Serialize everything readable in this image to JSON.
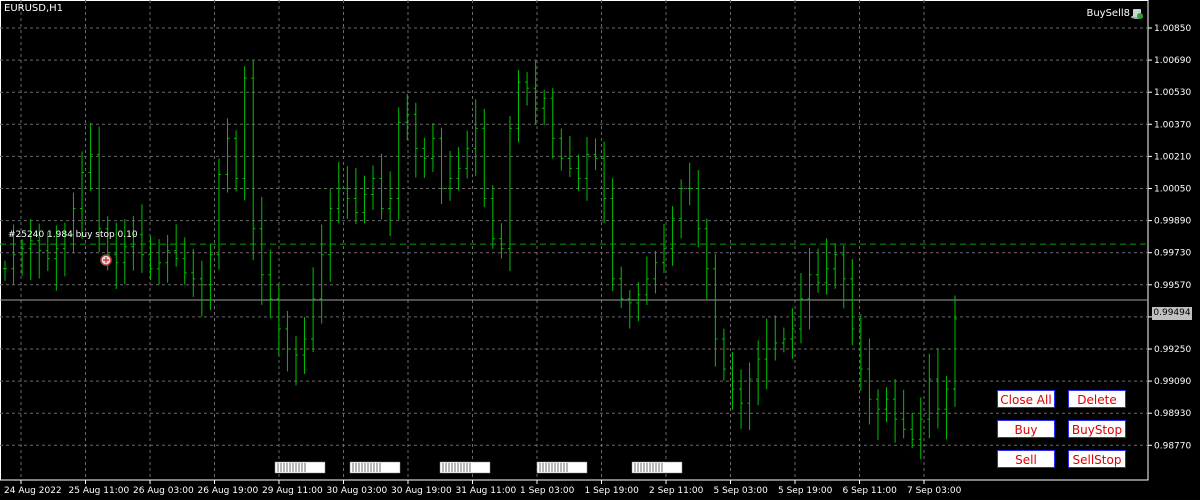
{
  "symbol_title": "EURUSD,H1",
  "ea_name": "BuySell8",
  "ea_icon": "expert-advisor-hat-icon",
  "pending_order_label": "#25240 1.984 buy stop 0.10",
  "current_price": "0.99494",
  "buttons": {
    "close_all": "Close All",
    "delete": "Delete",
    "buy": "Buy",
    "buy_stop": "BuyStop",
    "sell": "Sell",
    "sell_stop": "SellStop"
  },
  "colors": {
    "background": "#000000",
    "candles": "#00c000",
    "grid": "#6a6a6a",
    "order_line": "#00a000",
    "price_line": "#a0a0a0",
    "button_text": "#e00000",
    "button_border": "#2a2aff"
  },
  "chart_data": {
    "type": "line",
    "ylim": [
      0.9862,
      1.0095
    ],
    "y_ticks": [
      "1.00850",
      "1.00690",
      "1.00530",
      "1.00370",
      "1.00210",
      "1.00050",
      "0.99890",
      "0.99730",
      "0.99570",
      "0.99410",
      "0.99250",
      "0.99090",
      "0.98930",
      "0.98770"
    ],
    "x_ticks": [
      "24 Aug 2022",
      "25 Aug 11:00",
      "26 Aug 03:00",
      "26 Aug 19:00",
      "29 Aug 11:00",
      "30 Aug 03:00",
      "30 Aug 19:00",
      "31 Aug 11:00",
      "1 Sep 03:00",
      "1 Sep 19:00",
      "2 Sep 11:00",
      "5 Sep 03:00",
      "5 Sep 19:00",
      "6 Sep 11:00",
      "7 Sep 03:00"
    ],
    "order_level": 0.99773,
    "price_level": 0.99494,
    "closes": [
      0.9965,
      0.9972,
      0.9975,
      0.9979,
      0.9974,
      0.997,
      0.9975,
      0.9982,
      0.9995,
      1.0013,
      1.0022,
      0.9985,
      0.9972,
      0.9968,
      0.9976,
      0.9982,
      0.9972,
      0.9965,
      0.9968,
      0.9974,
      0.997,
      0.9963,
      0.996,
      0.9957,
      0.9972,
      1.0012,
      1.003,
      1.001,
      1.006,
      0.9985,
      0.9962,
      0.995,
      0.9935,
      0.9925,
      0.9922,
      0.993,
      0.995,
      0.9972,
      0.9995,
      1.0005,
      1.0,
      0.9993,
      1.0002,
      1.001,
      0.9995,
      1.0,
      1.0038,
      1.0042,
      1.0025,
      1.002,
      1.003,
      1.0005,
      1.001,
      1.0015,
      1.0025,
      1.0035,
      1.0,
      0.998,
      0.9975,
      1.0035,
      1.0058,
      1.0055,
      1.0045,
      1.005,
      1.003,
      1.002,
      1.0015,
      1.001,
      1.0022,
      1.002,
      1.0,
      0.996,
      0.995,
      0.9948,
      0.9952,
      0.996,
      0.9968,
      0.9975,
      0.999,
      1.0005,
      1.0005,
      0.9985,
      0.9965,
      0.993,
      0.9915,
      0.9905,
      0.9898,
      0.991,
      0.992,
      0.9925,
      0.9928,
      0.993,
      0.9935,
      0.995,
      0.9962,
      0.9958,
      0.9965,
      0.9972,
      0.996,
      0.9935,
      0.9915,
      0.99,
      0.9895,
      0.99,
      0.989,
      0.9885,
      0.988,
      0.989,
      0.991,
      0.9895,
      0.9905,
      0.994
    ]
  }
}
